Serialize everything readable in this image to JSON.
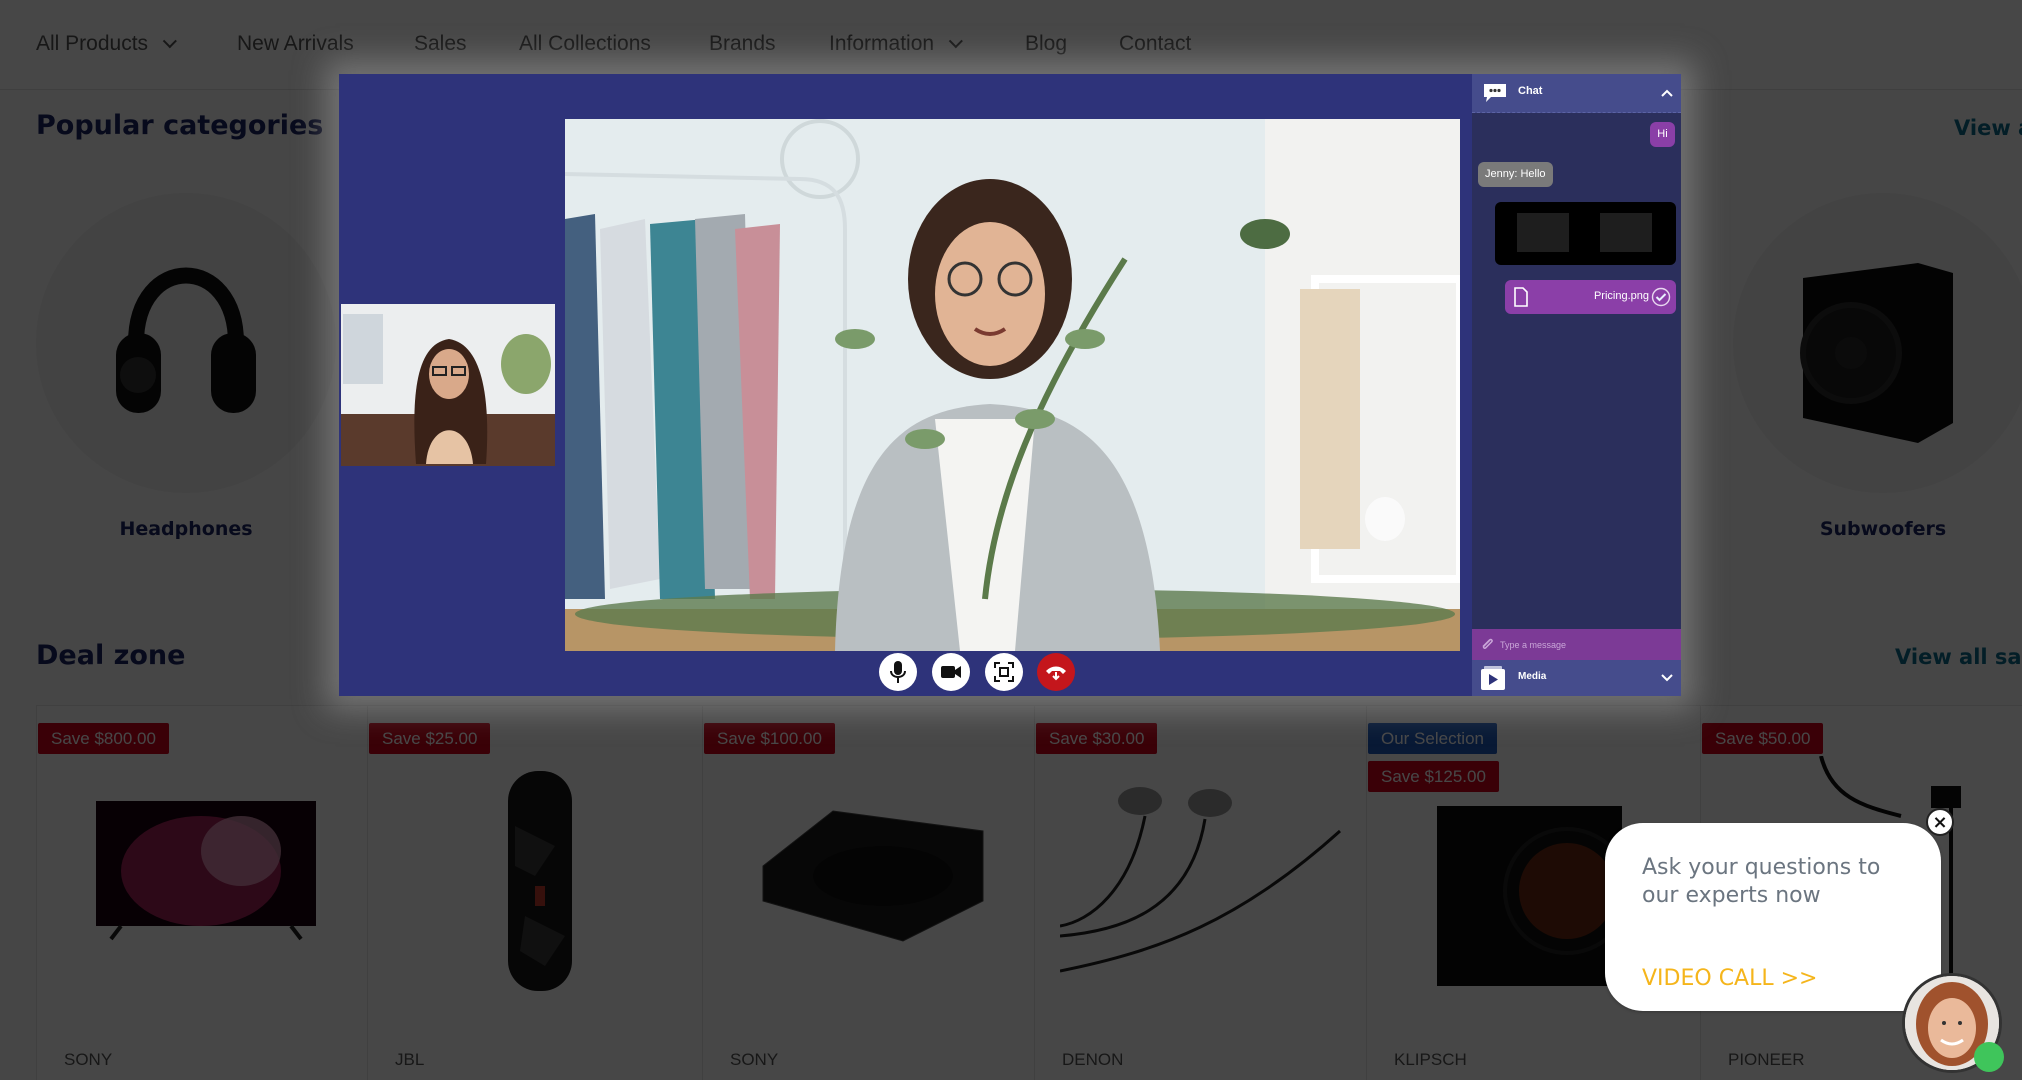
{
  "nav": {
    "items": [
      {
        "label": "All Products",
        "dropdown": true
      },
      {
        "label": "New Arrivals",
        "dropdown": false
      },
      {
        "label": "Sales",
        "dropdown": false
      },
      {
        "label": "All Collections",
        "dropdown": false
      },
      {
        "label": "Brands",
        "dropdown": false
      },
      {
        "label": "Information",
        "dropdown": true
      },
      {
        "label": "Blog",
        "dropdown": false
      },
      {
        "label": "Contact",
        "dropdown": false
      }
    ]
  },
  "popular": {
    "title": "Popular categories",
    "view_all": "View all",
    "categories": [
      {
        "label": "Headphones",
        "icon": "headphones-icon"
      },
      {
        "label": "Subwoofers",
        "icon": "subwoofer-icon"
      }
    ]
  },
  "deals": {
    "title": "Deal zone",
    "view_all": "View all sales",
    "products": [
      {
        "brand": "SONY",
        "badges": [
          {
            "text": "Save $800.00",
            "type": "red"
          }
        ],
        "image": "tv"
      },
      {
        "brand": "JBL",
        "badges": [
          {
            "text": "Save $25.00",
            "type": "red"
          }
        ],
        "image": "portable-speaker"
      },
      {
        "brand": "SONY",
        "badges": [
          {
            "text": "Save $100.00",
            "type": "red"
          }
        ],
        "image": "turntable"
      },
      {
        "brand": "DENON",
        "badges": [
          {
            "text": "Save $30.00",
            "type": "red"
          }
        ],
        "image": "earphones"
      },
      {
        "brand": "KLIPSCH",
        "badges": [
          {
            "text": "Our Selection",
            "type": "blue"
          },
          {
            "text": "Save $125.00",
            "type": "red"
          }
        ],
        "image": "subwoofer"
      },
      {
        "brand": "PIONEER",
        "badges": [
          {
            "text": "Save $50.00",
            "type": "red"
          }
        ],
        "image": "cable"
      }
    ]
  },
  "video_call": {
    "controls": [
      {
        "name": "microphone",
        "icon": "microphone-icon"
      },
      {
        "name": "camera",
        "icon": "video-camera-icon"
      },
      {
        "name": "screen-share",
        "icon": "screen-capture-icon"
      },
      {
        "name": "end-call",
        "icon": "hang-up-icon"
      }
    ],
    "chat": {
      "title": "Chat",
      "messages": [
        {
          "from": "me",
          "text": "Hi"
        },
        {
          "from": "them",
          "text": "Jenny: Hello"
        }
      ],
      "file": {
        "name": "Pricing.png",
        "status": "sent"
      },
      "input_placeholder": "Type a message",
      "media_label": "Media"
    }
  },
  "popup": {
    "text": "Ask your questions to our experts now",
    "cta": "VIDEO CALL >>",
    "close": "×",
    "agent_status": "online"
  },
  "colors": {
    "modal_bg": "#2e337a",
    "chat_header": "#454c8c",
    "chat_purple": "#8b3fa8",
    "end_call_red": "#c4161c",
    "badge_red": "#d0021b",
    "badge_blue": "#1e5bbf",
    "cta_yellow": "#f5b51b",
    "online_green": "#3fc55b"
  }
}
